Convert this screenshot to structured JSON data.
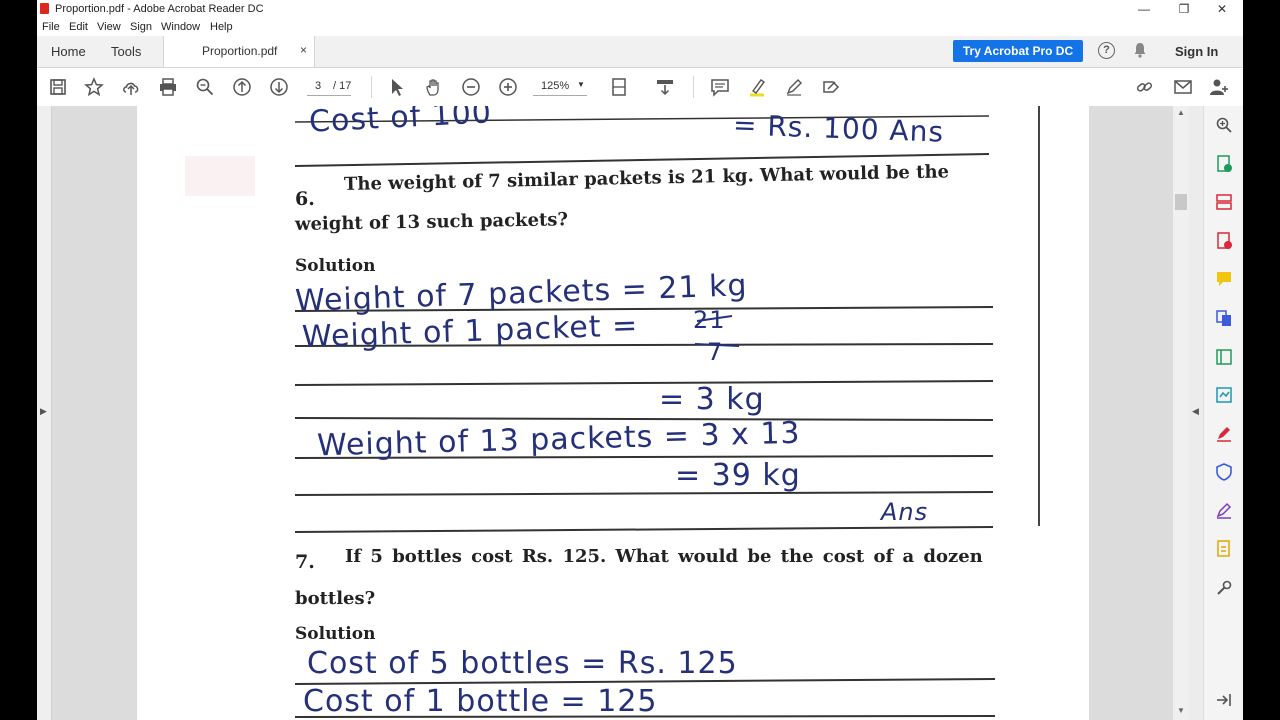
{
  "window": {
    "title": "Proportion.pdf - Adobe Acrobat Reader DC",
    "minimize": "—",
    "restore": "❐",
    "close": "✕"
  },
  "menu": [
    "File",
    "Edit",
    "View",
    "Sign",
    "Window",
    "Help"
  ],
  "tabs": {
    "home": "Home",
    "tools": "Tools",
    "document": "Proportion.pdf",
    "close": "×"
  },
  "header": {
    "try_pro": "Try Acrobat Pro DC",
    "help": "?",
    "sign_in": "Sign In"
  },
  "toolbar": {
    "page_current": "3",
    "page_total": "/ 17",
    "zoom": "125%",
    "zoom_arrow": "▼"
  },
  "nav": {
    "left_arrow": "◀",
    "right_arrow": "◀",
    "scroll_up": "▲",
    "scroll_down": "▼"
  },
  "document": {
    "top_hand_left": "Cost of 100",
    "top_hand_right": "= Rs. 100 Ans",
    "q6_number": "6.",
    "q6_line1": "The weight of 7 similar packets is 21 kg. What would be the",
    "q6_line2": "weight of 13 such packets?",
    "solution_label_1": "Solution",
    "q6_h1": "Weight of 7 packets = 21 kg",
    "q6_h2_left": "Weight of 1 packet =",
    "q6_h2_num": "21",
    "q6_h2_den": "7",
    "q6_h3": "= 3 kg",
    "q6_h4": "Weight of 13 packets = 3 x 13",
    "q6_h5": "= 39 kg",
    "q6_ans": "Ans",
    "q7_number": "7.",
    "q7_line1": "If 5 bottles cost Rs. 125. What would be the cost of a dozen",
    "q7_line2": "bottles?",
    "solution_label_2": "Solution",
    "q7_h1": "Cost of 5 bottles = Rs. 125",
    "q7_h2": "Cost of 1 bottle = 125"
  },
  "colors": {
    "accent": "#1473e6",
    "ink": "#24307a"
  }
}
